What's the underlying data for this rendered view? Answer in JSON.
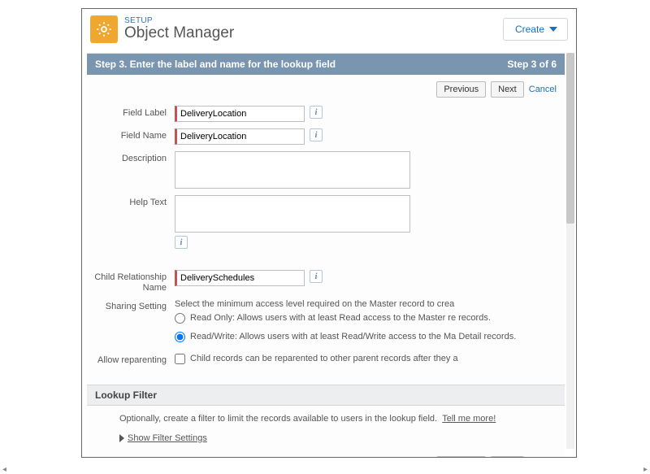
{
  "header": {
    "eyebrow": "SETUP",
    "title": "Object Manager",
    "create_label": "Create"
  },
  "step": {
    "title": "Step 3. Enter the label and name for the lookup field",
    "counter": "Step 3 of 6"
  },
  "buttons": {
    "previous": "Previous",
    "next": "Next",
    "cancel": "Cancel"
  },
  "form": {
    "field_label": {
      "label": "Field Label",
      "value": "DeliveryLocation"
    },
    "field_name": {
      "label": "Field Name",
      "value": "DeliveryLocation"
    },
    "description": {
      "label": "Description",
      "value": ""
    },
    "help_text": {
      "label": "Help Text",
      "value": ""
    },
    "child_rel_name": {
      "label": "Child Relationship Name",
      "value": "DeliverySchedules"
    },
    "sharing_setting": {
      "label": "Sharing Setting",
      "help": "Select the minimum access level required on the Master record to crea",
      "opt_readonly": "Read Only: Allows users with at least Read access to the Master re records.",
      "opt_readwrite": "Read/Write: Allows users with at least Read/Write access to the Ma Detail records."
    },
    "allow_reparenting": {
      "label": "Allow reparenting",
      "text": "Child records can be reparented to other parent records after they a"
    }
  },
  "lookup": {
    "title": "Lookup Filter",
    "body": "Optionally, create a filter to limit the records available to users in the lookup field.",
    "tell_me_more": "Tell me more!",
    "show_filter": "Show Filter Settings"
  }
}
